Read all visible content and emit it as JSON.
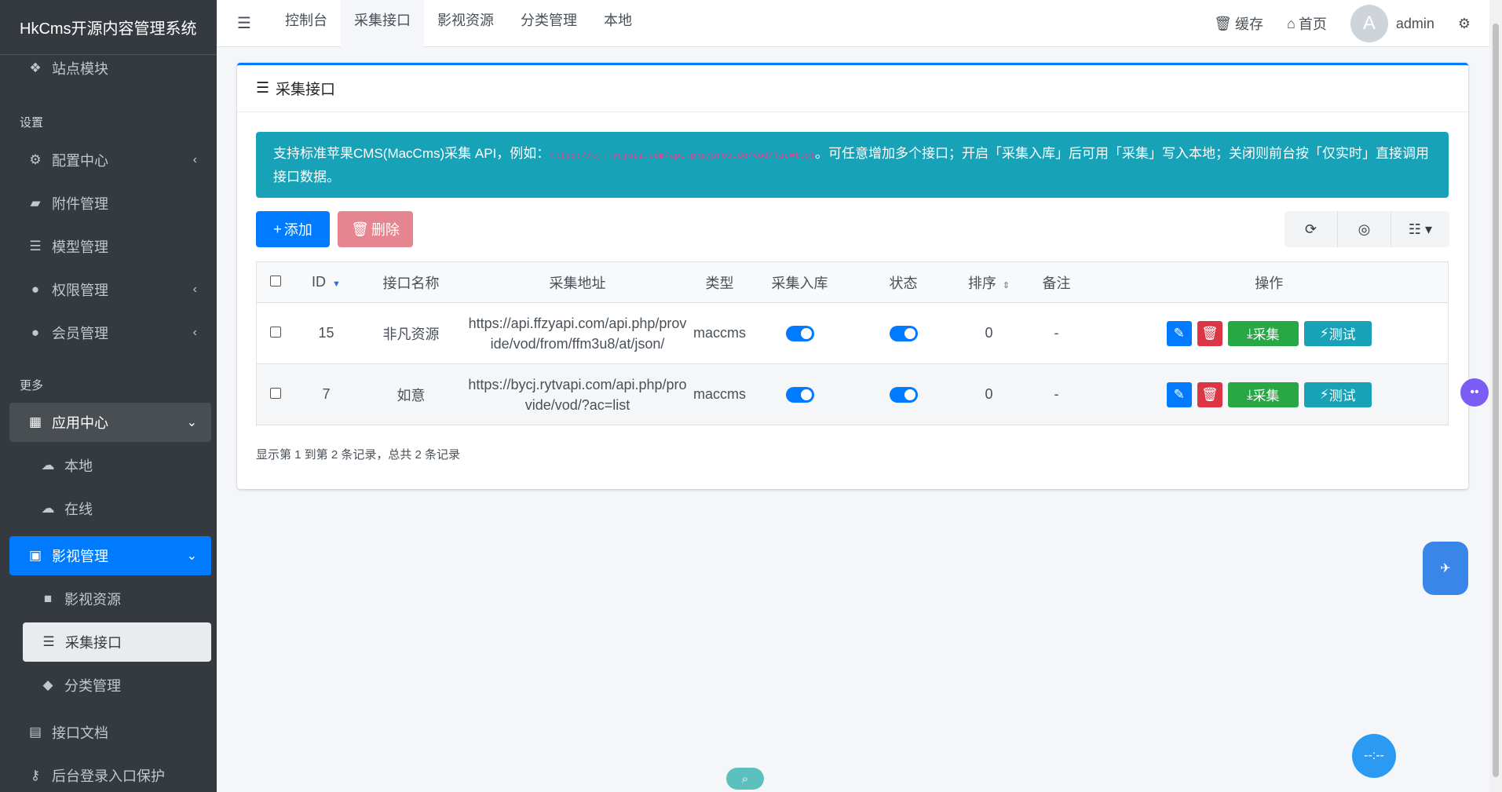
{
  "brand": "HkCms开源内容管理系统",
  "sidebar": {
    "top_item": "站点模块",
    "header_settings": "设置",
    "items": [
      {
        "label": "配置中心",
        "icon": "gear-icon"
      },
      {
        "label": "附件管理",
        "icon": "folder-icon"
      },
      {
        "label": "模型管理",
        "icon": "database-icon"
      },
      {
        "label": "权限管理",
        "icon": "user-icon"
      },
      {
        "label": "会员管理",
        "icon": "user-icon"
      }
    ],
    "header_more": "更多",
    "app_center": "应用中心",
    "local": "本地",
    "online": "在线",
    "video_manage": "影视管理",
    "video_resource": "影视资源",
    "collect_api": "采集接口",
    "category_manage": "分类管理",
    "api_docs": "接口文档",
    "login_protect": "后台登录入口保护"
  },
  "topnav": {
    "tabs": [
      "控制台",
      "采集接口",
      "影视资源",
      "分类管理",
      "本地"
    ],
    "cache": "缓存",
    "home": "首页",
    "avatar_letter": "A",
    "user": "admin"
  },
  "card": {
    "title": "采集接口",
    "alert_text_1": "支持标准苹果CMS(MacCms)采集 API，例如：",
    "alert_code": "https://cj.rycjapi.com/api.php/provide/vod/?ac=list",
    "alert_text_2": "。可任意增加多个接口；开启「采集入库」后可用「采集」写入本地；关闭则前台按「仅实时」直接调用接口数据。",
    "add_label": "添加",
    "delete_label": "删除"
  },
  "table": {
    "headers": [
      "ID",
      "接口名称",
      "采集地址",
      "类型",
      "采集入库",
      "状态",
      "排序",
      "备注",
      "操作"
    ],
    "rows": [
      {
        "id": "15",
        "name": "非凡资源",
        "url_1": "https://api.ffzyapi.com/api.php/prov",
        "url_2": "ide/vod/from/ffm3u8/at/json/",
        "type": "maccms",
        "sort": "0",
        "remark": "-",
        "collect": "采集",
        "test": "测试"
      },
      {
        "id": "7",
        "name": "如意",
        "url_1": "https://bycj.rytvapi.com/api.php/pro",
        "url_2": "vide/vod/?ac=list",
        "type": "maccms",
        "sort": "0",
        "remark": "-",
        "collect": "采集",
        "test": "测试"
      }
    ]
  },
  "pager_info": "显示第 1 到第 2 条记录，总共 2 条记录",
  "colors": {
    "primary": "#007bff",
    "info": "#17a2b8",
    "success": "#28a745",
    "danger": "#dc3545",
    "sidebar": "#343a40"
  }
}
